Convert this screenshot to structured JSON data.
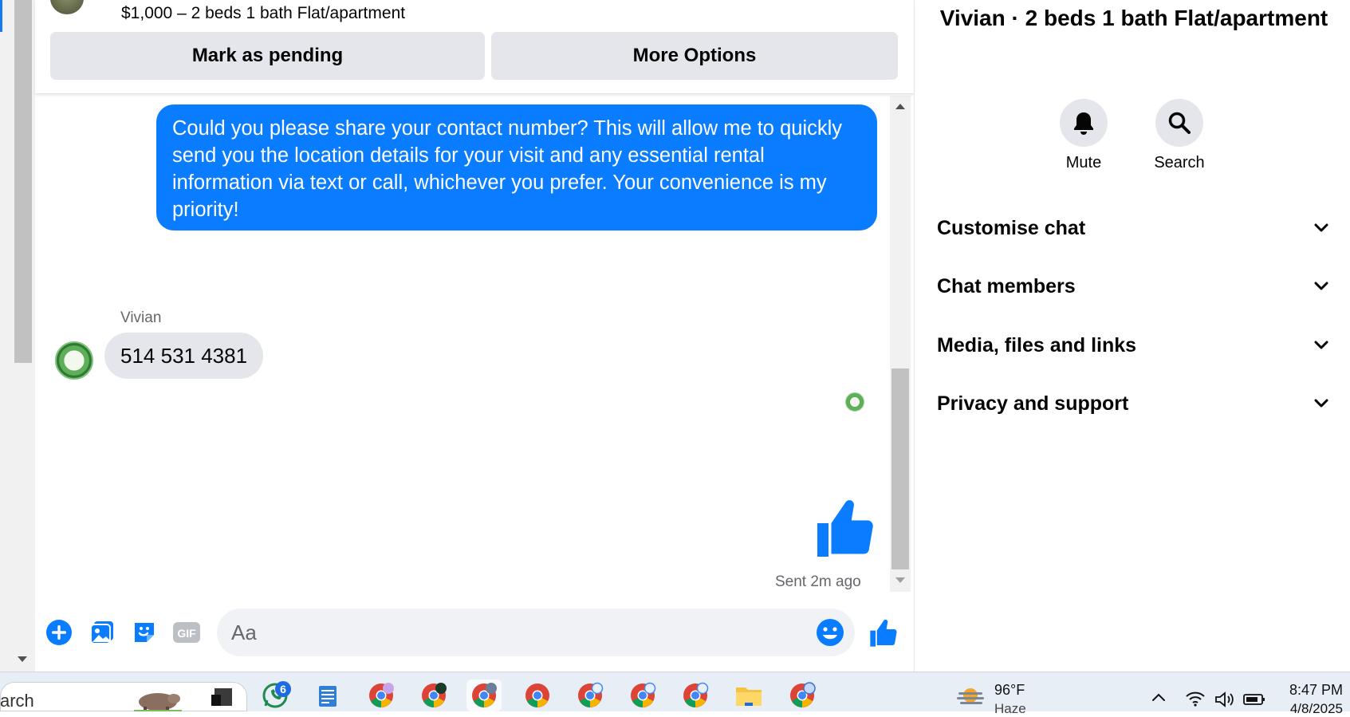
{
  "listing": {
    "title": "$1,000 – 2 beds 1 bath Flat/apartment",
    "mark_pending_label": "Mark as pending",
    "more_options_label": "More Options"
  },
  "messages": {
    "outgoing_text": "Could you please share your contact number? This will allow me to quickly send you the location details for your visit and any essential rental information via text or call, whichever you prefer. Your convenience is my priority!",
    "incoming_sender": "Vivian",
    "incoming_text": "514 531 4381",
    "sent_status": "Sent 2m ago"
  },
  "composer": {
    "placeholder": "Aa",
    "icons": [
      "plus-icon",
      "photo-icon",
      "sticker-icon",
      "gif-icon",
      "emoji-icon",
      "thumbs-up-icon"
    ],
    "gif_label": "GIF"
  },
  "info_panel": {
    "title": "Vivian · 2 beds 1 bath Flat/apartment",
    "mute_label": "Mute",
    "search_label": "Search",
    "sections": [
      {
        "label": "Customise chat"
      },
      {
        "label": "Chat members"
      },
      {
        "label": "Media, files and links"
      },
      {
        "label": "Privacy and support"
      }
    ]
  },
  "taskbar": {
    "search_text": "arch",
    "whatsapp_badge": "6",
    "weather_temp": "96°F",
    "weather_condition": "Haze",
    "time": "8:47 PM",
    "date": "4/8/2025"
  },
  "colors": {
    "messenger_blue": "#0a7cff",
    "bubble_gray": "#e4e6eb",
    "secondary_text": "#65676b"
  }
}
